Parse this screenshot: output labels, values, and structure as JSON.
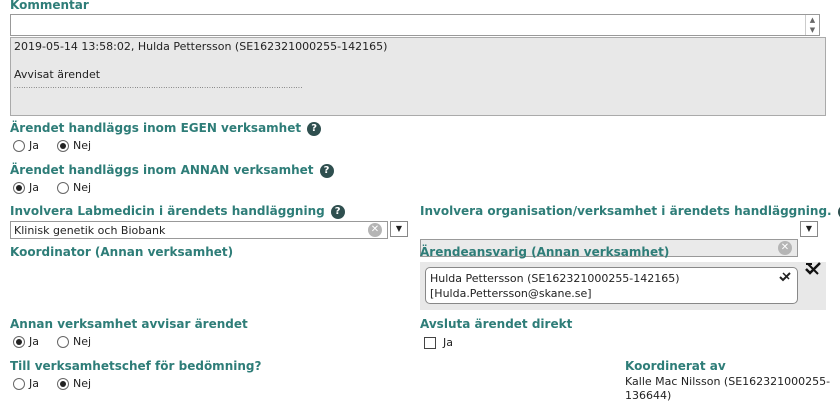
{
  "comment": {
    "heading": "Kommentar",
    "input_value": "",
    "log_line1": "2019-05-14 13:58:02, Hulda Pettersson (SE162321000255-142165)",
    "log_line2": "Avvisat ärendet",
    "log_dots": "........................................................................................................................"
  },
  "egen": {
    "heading": "Ärendet handläggs inom EGEN verksamhet",
    "ja": "Ja",
    "nej": "Nej",
    "selected": "Nej"
  },
  "annan": {
    "heading": "Ärendet handläggs inom ANNAN verksamhet",
    "ja": "Ja",
    "nej": "Nej",
    "selected": "Ja"
  },
  "labmedicin": {
    "heading": "Involvera Labmedicin i ärendets handläggning",
    "value": "Klinisk genetik och Biobank"
  },
  "organisation": {
    "heading": "Involvera organisation/verksamhet i ärendets handläggning.",
    "value": ""
  },
  "koordinator": {
    "heading": "Koordinator (Annan verksamhet)"
  },
  "ansvarig": {
    "heading": "Ärendeansvarig (Annan verksamhet)",
    "line1": "Hulda Pettersson (SE162321000255-142165)",
    "line2": "[Hulda.Pettersson@skane.se]"
  },
  "avvisar": {
    "heading": "Annan verksamhet avvisar ärendet",
    "ja": "Ja",
    "nej": "Nej",
    "selected": "Ja"
  },
  "avsluta": {
    "heading": "Avsluta ärendet direkt",
    "label": "Ja",
    "checked": false
  },
  "chef": {
    "heading": "Till verksamhetschef för bedömning?",
    "ja": "Ja",
    "nej": "Nej",
    "selected": "Nej"
  },
  "koordinerat": {
    "heading": "Koordinerat av",
    "line1": "Kalle Mac Nilsson (SE162321000255-",
    "line2": "136644)"
  },
  "help_glyph": "?",
  "clear_glyph": "✕",
  "dropdown_glyph": "▼"
}
